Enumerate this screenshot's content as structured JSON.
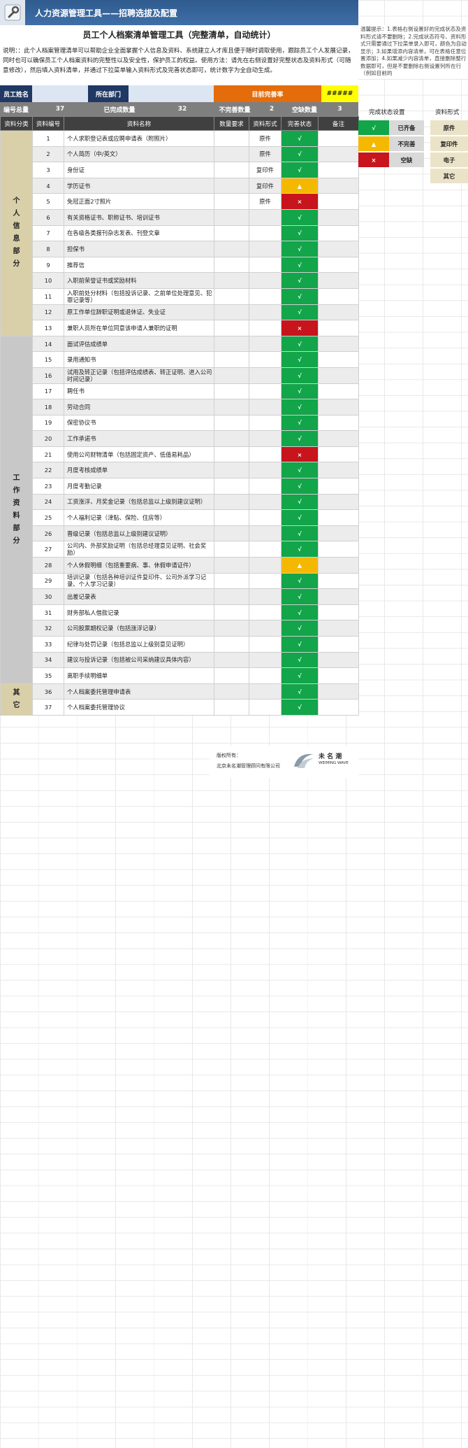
{
  "header": {
    "title": "人力资源管理工具——招聘选拔及配置",
    "icon": "wrench-icon"
  },
  "doc_title": "员工个人档案清单管理工具（完整清单，自动统计）",
  "description": "说明：：此个人档案管理清单可以帮助企业全面掌握个人信息及资料、系统建立人才库且便于随时调取使用，跟踪员工个人发展记录，同时也可以确保员工个人档案资料的完整性以及安全性，保护员工的权益。使用方法：请先在右侧设置好完整状态及资料形式（可随意修改），然后填入资料清单，并通过下拉菜单输入资料形式及完善状态即可，统计数字为全自动生成。",
  "info_row": {
    "employee_name_label": "员工姓名",
    "employee_name_value": "",
    "dept_label": "所在部门",
    "dept_value": "",
    "rate_label": "目前完善率",
    "rate_value": "#####"
  },
  "stats_row": {
    "total_label": "编号总量",
    "total_value": "37",
    "done_label": "已完成数量",
    "done_value": "32",
    "incomplete_label": "不完善数量",
    "incomplete_value": "2",
    "missing_label": "空缺数量",
    "missing_value": "3"
  },
  "columns": [
    "资料分类",
    "资料编号",
    "资料名称",
    "数量要求",
    "资料形式",
    "完善状态",
    "备注"
  ],
  "categories": [
    {
      "label": "个\n人\n信\n息\n部\n分"
    },
    {
      "label": "工\n作\n资\n料\n部\n分"
    },
    {
      "label": "其\n它"
    }
  ],
  "rows": [
    {
      "no": "1",
      "name": "个人求职登记表或应聘申请表（附照片）",
      "form": "原件",
      "status": "√",
      "color": "green"
    },
    {
      "no": "2",
      "name": "个人简历（中/英文）",
      "form": "原件",
      "status": "√",
      "color": "green"
    },
    {
      "no": "3",
      "name": "身份证",
      "form": "复印件",
      "status": "√",
      "color": "green"
    },
    {
      "no": "4",
      "name": "学历证书",
      "form": "复印件",
      "status": "▲",
      "color": "amber"
    },
    {
      "no": "5",
      "name": "免冠正面2寸照片",
      "form": "原件",
      "status": "×",
      "color": "red"
    },
    {
      "no": "6",
      "name": "有关资格证书、职称证书、培训证书",
      "form": "",
      "status": "√",
      "color": "green"
    },
    {
      "no": "7",
      "name": "在各级各类报刊杂志发表、刊登文章",
      "form": "",
      "status": "√",
      "color": "green"
    },
    {
      "no": "8",
      "name": "担保书",
      "form": "",
      "status": "√",
      "color": "green"
    },
    {
      "no": "9",
      "name": "推荐信",
      "form": "",
      "status": "√",
      "color": "green"
    },
    {
      "no": "10",
      "name": "入职前荣誉证书或奖励材料",
      "form": "",
      "status": "√",
      "color": "green"
    },
    {
      "no": "11",
      "name": "入职前处分材料（包括投诉记录、之前单位处理意见、犯罪记录等）",
      "form": "",
      "status": "√",
      "color": "green"
    },
    {
      "no": "12",
      "name": "原工作单位辞职证明或退休证、失业证",
      "form": "",
      "status": "√",
      "color": "green"
    },
    {
      "no": "13",
      "name": "兼职人员所在单位同意该申请人兼职的证明",
      "form": "",
      "status": "×",
      "color": "red"
    },
    {
      "no": "14",
      "name": "面试评估成绩单",
      "form": "",
      "status": "√",
      "color": "green"
    },
    {
      "no": "15",
      "name": "录用通知书",
      "form": "",
      "status": "√",
      "color": "green"
    },
    {
      "no": "16",
      "name": "试用及转正记录（包括评估成绩表、转正证明、进入公司时间记录）",
      "form": "",
      "status": "√",
      "color": "green"
    },
    {
      "no": "17",
      "name": "聘任书",
      "form": "",
      "status": "√",
      "color": "green"
    },
    {
      "no": "18",
      "name": "劳动合同",
      "form": "",
      "status": "√",
      "color": "green"
    },
    {
      "no": "19",
      "name": "保密协议书",
      "form": "",
      "status": "√",
      "color": "green"
    },
    {
      "no": "20",
      "name": "工作承诺书",
      "form": "",
      "status": "√",
      "color": "green"
    },
    {
      "no": "21",
      "name": "使用公司财物清单（包括固定资产、低值易耗品）",
      "form": "",
      "status": "×",
      "color": "red"
    },
    {
      "no": "22",
      "name": "月度考核成绩单",
      "form": "",
      "status": "√",
      "color": "green"
    },
    {
      "no": "23",
      "name": "月度考勤记录",
      "form": "",
      "status": "√",
      "color": "green"
    },
    {
      "no": "24",
      "name": "工资涨浮、月奖金记录（包括总监以上级别建议证明）",
      "form": "",
      "status": "√",
      "color": "green"
    },
    {
      "no": "25",
      "name": "个人福利记录（津贴、保险、住房等）",
      "form": "",
      "status": "√",
      "color": "green"
    },
    {
      "no": "26",
      "name": "晋级记录（包括总监以上级别建议证明）",
      "form": "",
      "status": "√",
      "color": "green"
    },
    {
      "no": "27",
      "name": "公司内、外部奖励证明（包括总经理意见证明、社会奖励）",
      "form": "",
      "status": "√",
      "color": "green"
    },
    {
      "no": "28",
      "name": "个人休假明细（包括重要病、事、休假申请证件）",
      "form": "",
      "status": "▲",
      "color": "amber"
    },
    {
      "no": "29",
      "name": "培训记录（包括各种培训证件复印件、公司外派学习记录、个人学习记录）",
      "form": "",
      "status": "√",
      "color": "green"
    },
    {
      "no": "30",
      "name": "出差记录表",
      "form": "",
      "status": "√",
      "color": "green"
    },
    {
      "no": "31",
      "name": "财务部私人借款记录",
      "form": "",
      "status": "√",
      "color": "green"
    },
    {
      "no": "32",
      "name": "公司股票期权记录（包括涨浮记录）",
      "form": "",
      "status": "√",
      "color": "green"
    },
    {
      "no": "33",
      "name": "纪律与处罚记录（包括总监以上级别意见证明）",
      "form": "",
      "status": "√",
      "color": "green"
    },
    {
      "no": "34",
      "name": "建议与投诉记录（包括被公司采纳建议具体内容）",
      "form": "",
      "status": "√",
      "color": "green"
    },
    {
      "no": "35",
      "name": "离职手续明细单",
      "form": "",
      "status": "√",
      "color": "green"
    },
    {
      "no": "36",
      "name": "个人档案委托管理申请表",
      "form": "",
      "status": "√",
      "color": "green"
    },
    {
      "no": "37",
      "name": "个人档案委托管理协议",
      "form": "",
      "status": "√",
      "color": "green"
    }
  ],
  "side_note": "温馨提示：1.表格右侧设置好的完成状态及资料形式请不要删除；2.完成状态符号、资料形式只需要通过下拉菜单录入即可，颜色为自动显示；3.如果增添内容清单，可在表格任意位置添加；4.如果减少内容清单，直接删除整行数据即可，但是不要删除右侧设置列所在行（例如目前的",
  "legend": {
    "status_header": "完成状态设置",
    "form_header": "资料形式",
    "status_items": [
      {
        "symbol": "√",
        "label": "已齐备",
        "color": "#12a54a"
      },
      {
        "symbol": "▲",
        "label": "不完善",
        "color": "#f5b800"
      },
      {
        "symbol": "×",
        "label": "空缺",
        "color": "#c8141c"
      }
    ],
    "form_items": [
      "原件",
      "复印件",
      "电子",
      "其它"
    ]
  },
  "footer": {
    "copyright_label": "版权所有：",
    "company": "北京未名潮管理顾问有限公司",
    "brand_cn": "未 名 潮",
    "brand_en": "WEIMING WAVE"
  }
}
